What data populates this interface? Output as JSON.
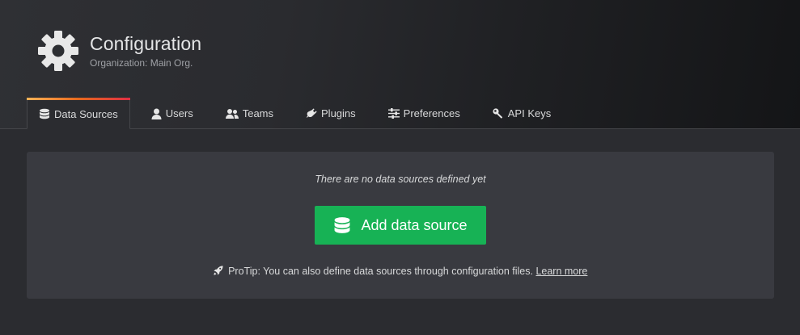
{
  "header": {
    "icon": "gear-icon",
    "title": "Configuration",
    "subtitle": "Organization: Main Org."
  },
  "tabs": [
    {
      "label": "Data Sources",
      "icon": "database-icon",
      "active": true
    },
    {
      "label": "Users",
      "icon": "user-icon",
      "active": false
    },
    {
      "label": "Teams",
      "icon": "team-icon",
      "active": false
    },
    {
      "label": "Plugins",
      "icon": "plug-icon",
      "active": false
    },
    {
      "label": "Preferences",
      "icon": "sliders-icon",
      "active": false
    },
    {
      "label": "API Keys",
      "icon": "key-icon",
      "active": false
    }
  ],
  "empty_state": {
    "message": "There are no data sources defined yet",
    "button_label": "Add data source",
    "button_icon": "database-icon",
    "protip_icon": "rocket-icon",
    "protip_text": "ProTip: You can also define data sources through configuration files.",
    "protip_link": "Learn more"
  },
  "colors": {
    "accent_green": "#17b255",
    "tab_highlight_start": "#ffb357",
    "tab_highlight_end": "#e02f44",
    "card_background": "#393a40"
  }
}
